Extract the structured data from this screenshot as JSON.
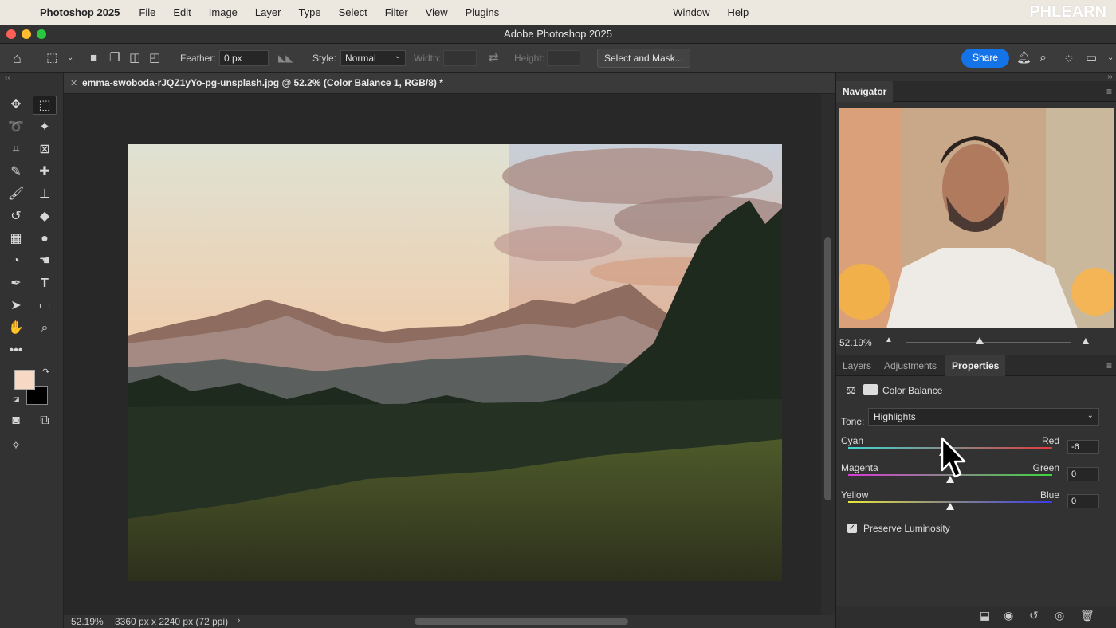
{
  "menubar": {
    "app_name": "Photoshop 2025",
    "items": [
      "File",
      "Edit",
      "Image",
      "Layer",
      "Type",
      "Select",
      "Filter",
      "View",
      "Plugins",
      "Window",
      "Help"
    ],
    "watermark": "PHLEARN"
  },
  "window": {
    "title": "Adobe Photoshop 2025"
  },
  "options": {
    "feather_label": "Feather:",
    "feather_value": "0 px",
    "style_label": "Style:",
    "style_value": "Normal",
    "width_label": "Width:",
    "height_label": "Height:",
    "select_mask": "Select and Mask...",
    "share": "Share"
  },
  "document": {
    "tab": "emma-swoboda-rJQZ1yYo-pg-unsplash.jpg @ 52.2% (Color Balance 1, RGB/8) *",
    "zoom": "52.19%",
    "size": "3360 px x 2240 px (72 ppi)"
  },
  "colors": {
    "foreground": "#f6d8c4",
    "background": "#000000",
    "share_blue": "#1473e6"
  },
  "navigator": {
    "title": "Navigator",
    "zoom": "52.19%"
  },
  "panel_tabs": [
    "Layers",
    "Adjustments",
    "Properties"
  ],
  "properties": {
    "title": "Color Balance",
    "tone_label": "Tone:",
    "tone_value": "Highlights",
    "sliders": [
      {
        "left": "Cyan",
        "right": "Red",
        "value": "-6"
      },
      {
        "left": "Magenta",
        "right": "Green",
        "value": "0"
      },
      {
        "left": "Yellow",
        "right": "Blue",
        "value": "0"
      }
    ],
    "preserve": "Preserve Luminosity"
  }
}
